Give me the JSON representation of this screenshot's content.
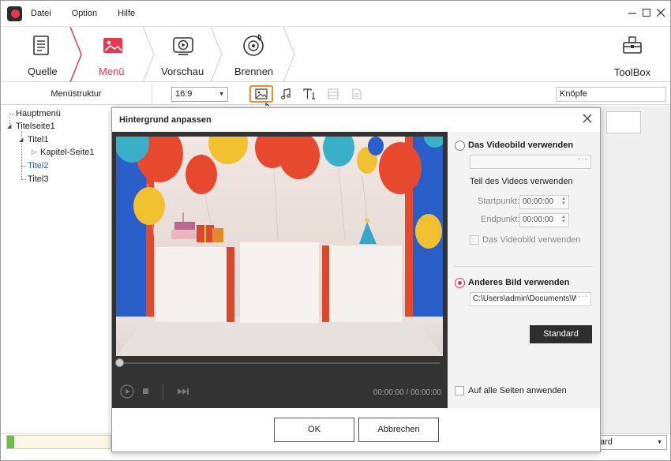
{
  "menu": {
    "file": "Datei",
    "option": "Option",
    "help": "Hilfe"
  },
  "steps": {
    "source": "Quelle",
    "menu": "Menü",
    "preview": "Vorschau",
    "burn": "Brennen",
    "toolbox": "ToolBox"
  },
  "toolbar": {
    "menu_structure": "Menüstruktur",
    "aspect_ratio": "16:9",
    "buttons_field": "Knöpfe"
  },
  "tree": {
    "items": [
      "Hauptmenü",
      "Titelseite1",
      "Titel1",
      "Kapitel-Seite1",
      "Titel2",
      "Titel3"
    ]
  },
  "dialog": {
    "title": "Hintergrund anpassen",
    "option_video": "Das Videobild verwenden",
    "video_part": "Teil des Videos verwenden",
    "start_label": "Startpunkt:",
    "start_value": "00:00:00",
    "end_label": "Endpunkt:",
    "end_value": "00:00:00",
    "use_videoframe_check": "Das Videobild verwenden",
    "option_image": "Anderes Bild verwenden",
    "image_path": "C:\\Users\\admin\\Documents\\W",
    "standard_button": "Standard",
    "apply_all": "Auf alle Seiten anwenden",
    "time_display": "00:00:00 / 00:00:00",
    "ok": "OK",
    "cancel": "Abbrechen"
  },
  "bottom": {
    "select_value": "ard"
  },
  "progress": {
    "fraction": 0.07
  },
  "colors": {
    "accent": "#e53950",
    "highlight": "#f08a2c",
    "dark": "#2e2e2e"
  }
}
